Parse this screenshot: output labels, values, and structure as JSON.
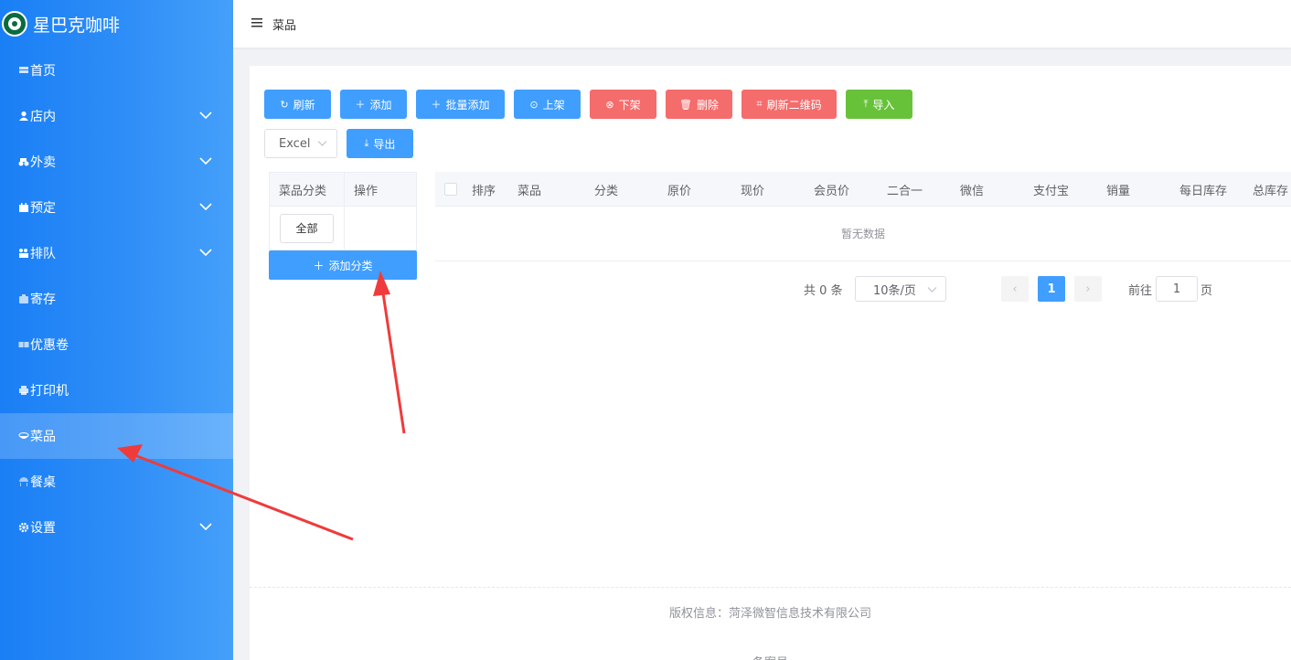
{
  "brand": {
    "name": "星巴克咖啡"
  },
  "sidebar": {
    "items": [
      {
        "label": "首页",
        "icon": "home-icon",
        "expandable": false,
        "active": false
      },
      {
        "label": "店内",
        "icon": "user-icon",
        "expandable": true,
        "active": false
      },
      {
        "label": "外卖",
        "icon": "delivery-icon",
        "expandable": true,
        "active": false
      },
      {
        "label": "预定",
        "icon": "reserve-icon",
        "expandable": true,
        "active": false
      },
      {
        "label": "排队",
        "icon": "queue-icon",
        "expandable": true,
        "active": false
      },
      {
        "label": "寄存",
        "icon": "storage-icon",
        "expandable": false,
        "active": false
      },
      {
        "label": "优惠卷",
        "icon": "coupon-icon",
        "expandable": false,
        "active": false
      },
      {
        "label": "打印机",
        "icon": "printer-icon",
        "expandable": false,
        "active": false
      },
      {
        "label": "菜品",
        "icon": "dish-icon",
        "expandable": false,
        "active": true
      },
      {
        "label": "餐桌",
        "icon": "table-icon",
        "expandable": false,
        "active": false
      },
      {
        "label": "设置",
        "icon": "gear-icon",
        "expandable": true,
        "active": false
      }
    ]
  },
  "header": {
    "breadcrumb": "菜品"
  },
  "toolbar": {
    "refresh": "刷新",
    "add": "添加",
    "batch_add": "批量添加",
    "on_shelf": "上架",
    "off_shelf": "下架",
    "delete": "删除",
    "refresh_qr": "刷新二维码",
    "import": "导入",
    "export_format": "Excel",
    "export": "导出"
  },
  "category_table": {
    "headers": [
      "菜品分类",
      "操作"
    ],
    "rows": [
      {
        "name": "全部"
      }
    ],
    "add_label": "添加分类"
  },
  "dish_table": {
    "headers": [
      "排序",
      "菜品",
      "分类",
      "原价",
      "现价",
      "会员价",
      "二合一",
      "微信",
      "支付宝",
      "销量",
      "每日库存",
      "总库存"
    ],
    "empty_text": "暂无数据"
  },
  "pagination": {
    "total_label": "共 0 条",
    "page_size": "10条/页",
    "current_page": "1",
    "goto_label": "前往",
    "goto_value": "1",
    "page_suffix": "页"
  },
  "footer": {
    "copyright": "版权信息：菏泽微智信息技术有限公司",
    "icp": "备案号"
  },
  "colors": {
    "sidebar": "#1a7ff5",
    "primary": "#409eff",
    "danger": "#f56c6c",
    "success": "#67c23a",
    "annotation": "#ef3b3b"
  }
}
